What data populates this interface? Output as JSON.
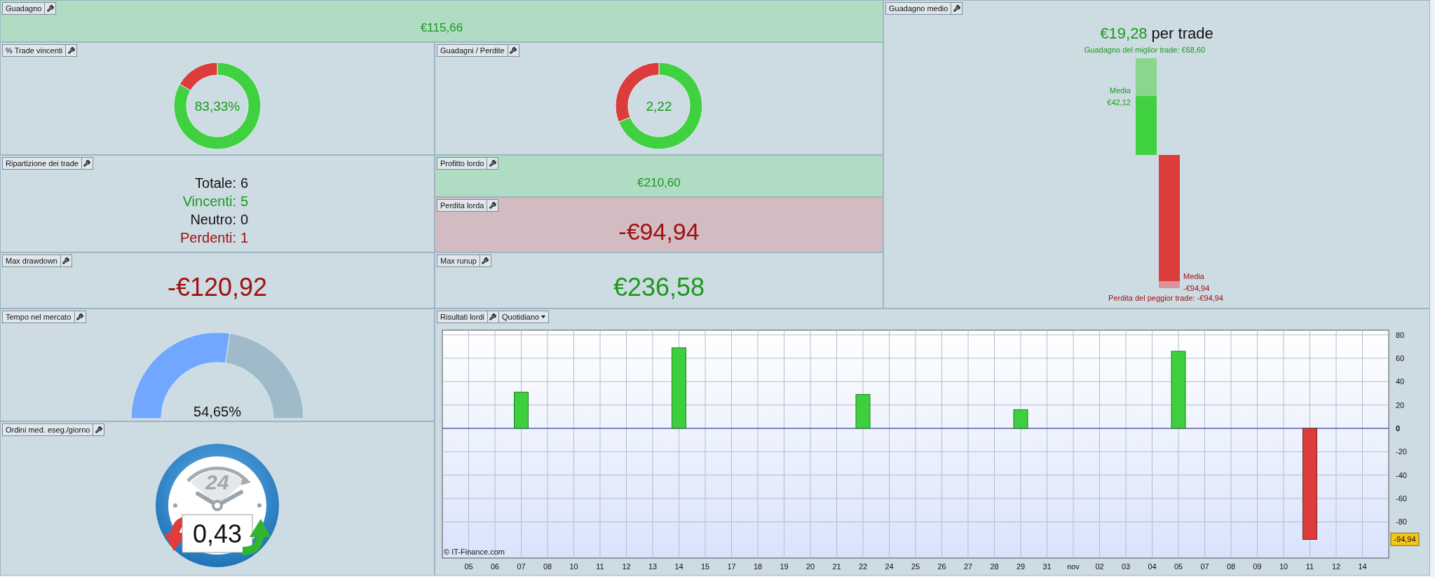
{
  "profit": {
    "title": "Guadagno",
    "value": "€115,66",
    "kind": "positive",
    "highlighted": true
  },
  "win_rate": {
    "title": "% Trade vincenti",
    "value": "83,33%",
    "chart_data": {
      "type": "donut",
      "values": [
        83.33,
        16.67
      ]
    }
  },
  "gain_loss": {
    "title": "Guadagni / Perdite",
    "value": "2,22",
    "chart_data": {
      "type": "donut",
      "values": [
        68.93,
        31.07
      ]
    }
  },
  "breakdown": {
    "title": "Ripartizione dei trade",
    "rows": [
      {
        "label": "Totale:",
        "value": "6",
        "color": "#111111"
      },
      {
        "label": "Vincenti:",
        "value": "5",
        "color": "#1a9a1a"
      },
      {
        "label": "Neutro:",
        "value": "0",
        "color": "#111111"
      },
      {
        "label": "Perdenti:",
        "value": "1",
        "color": "#a01010"
      }
    ]
  },
  "gross_profit": {
    "title": "Profitto lordo",
    "value": "€210,60",
    "kind": "positive",
    "highlighted": true
  },
  "gross_loss": {
    "title": "Perdita lorda",
    "value": "-€94,94",
    "kind": "negative",
    "highlighted": true
  },
  "max_drawdown": {
    "title": "Max drawdown",
    "value": "-€120,92",
    "kind": "negative",
    "highlighted": false
  },
  "max_runup": {
    "title": "Max runup",
    "value": "€236,58",
    "kind": "positive",
    "highlighted": false
  },
  "average_gain": {
    "title": "Guadagno medio",
    "value": "€19,28",
    "suffix": "per trade",
    "best_trade": "Guadagno del miglior trade: €68,60",
    "win_average_label": "Media",
    "win_average": "€42,12",
    "loss_average_label": "Media",
    "loss_average": "-€94,94",
    "worst_trade": "Perdita del peggior trade: -€94,94"
  },
  "time_in_market": {
    "title": "Tempo nel mercato",
    "value": "54,65%",
    "level": 0.5465
  },
  "orders_per_day": {
    "title": "Ordini med. eseg./giorno",
    "clock_label": "24",
    "value": "0,43"
  },
  "gross_results": {
    "title": "Risultati lordi",
    "period": "Quotidiano",
    "credit": "© IT-Finance.com",
    "chart_data": {
      "type": "bar",
      "categories": [
        "05",
        "06",
        "07",
        "08",
        "10",
        "11",
        "12",
        "13",
        "14",
        "15",
        "17",
        "18",
        "19",
        "20",
        "21",
        "22",
        "24",
        "25",
        "26",
        "27",
        "28",
        "29",
        "31",
        "nov",
        "02",
        "03",
        "04",
        "05",
        "07",
        "08",
        "09",
        "10",
        "11",
        "12",
        "14"
      ],
      "series": [
        {
          "values": [
            null,
            null,
            31,
            null,
            null,
            null,
            null,
            null,
            69,
            null,
            null,
            null,
            null,
            null,
            null,
            29,
            null,
            null,
            null,
            null,
            null,
            16,
            null,
            null,
            null,
            null,
            null,
            66,
            null,
            null,
            null,
            null,
            -95,
            null,
            null
          ]
        }
      ],
      "ylim": [
        -111,
        84
      ],
      "yticks": [
        80,
        60,
        40,
        20,
        0,
        -20,
        -40,
        -60,
        -80
      ],
      "grid": true,
      "ref_lines": [
        {
          "axis": "y",
          "value": 0
        }
      ],
      "annotations": [
        {
          "y": -94.94,
          "text": "-94,94"
        }
      ]
    }
  }
}
